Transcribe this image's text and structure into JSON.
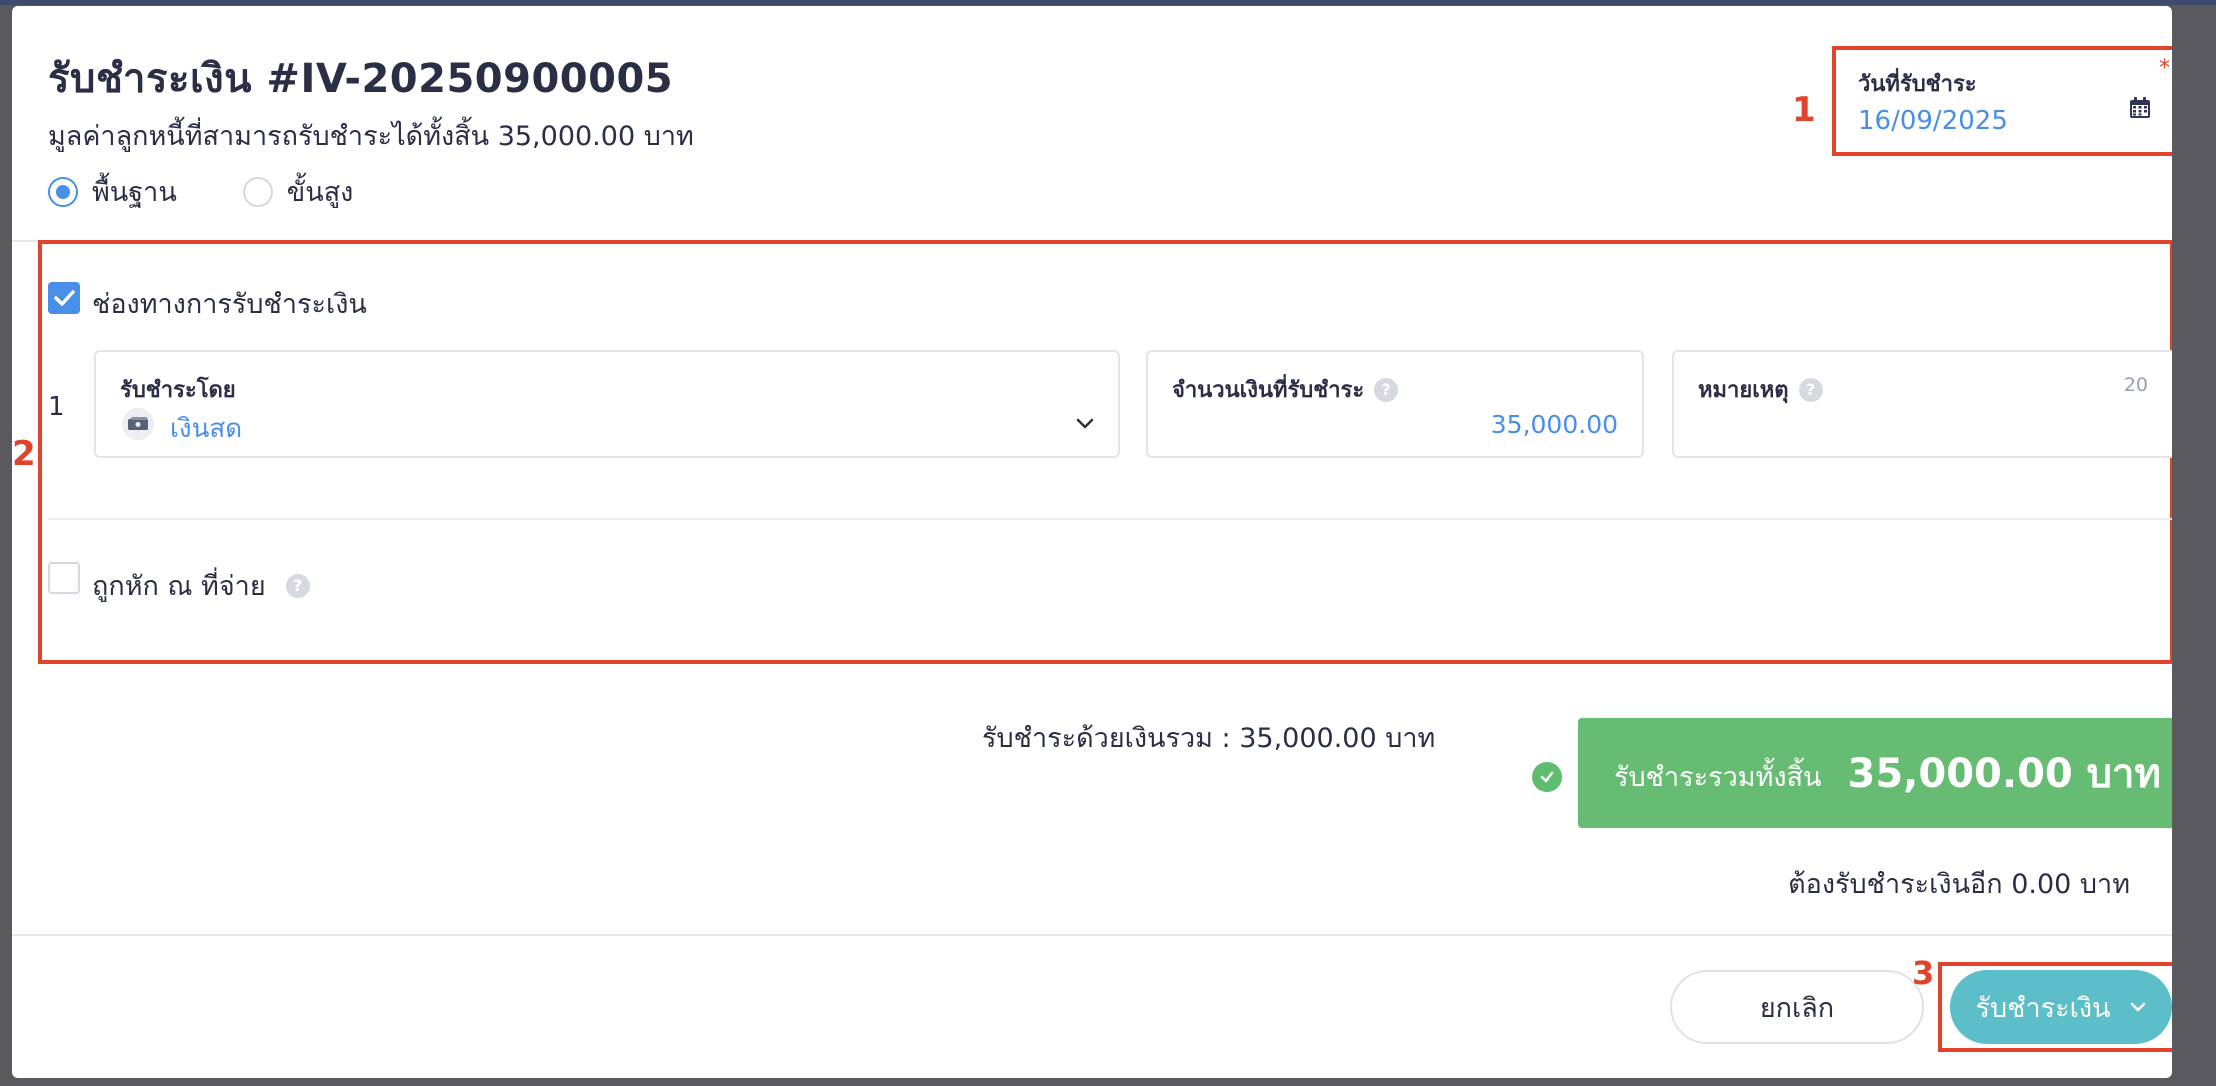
{
  "header": {
    "title": "รับชำระเงิน #IV-20250900005",
    "subtitle": "มูลค่าลูกหนี้ที่สามารถรับชำระได้ทั้งสิ้น 35,000.00 บาท"
  },
  "mode": {
    "options": [
      {
        "label": "พื้นฐาน",
        "selected": true
      },
      {
        "label": "ขั้นสูง",
        "selected": false
      }
    ]
  },
  "date": {
    "label": "วันที่รับชำระ",
    "required_mark": "*",
    "value": "16/09/2025",
    "icon": "calendar-icon"
  },
  "annotations": [
    "1",
    "2",
    "3"
  ],
  "payment_channel": {
    "label": "ช่องทางการรับชำระเงิน",
    "checked": true,
    "rows": [
      {
        "index": "1",
        "method_label": "รับชำระโดย",
        "method_value": "เงินสด",
        "method_icon": "cash-icon",
        "amount_label": "จำนวนเงินที่รับชำระ",
        "amount_value": "35,000.00",
        "note_label": "หมายเหตุ",
        "note_counter": "20"
      }
    ]
  },
  "withholding": {
    "label": "ถูกหัก ณ ที่จ่าย",
    "checked": false
  },
  "summary": {
    "paid_with_total": "รับชำระด้วยเงินรวม :  35,000.00 บาท",
    "total_label": "รับชำระรวมทั้งสิ้น",
    "total_value": "35,000.00 บาท",
    "remaining": "ต้องรับชำระเงินอีก 0.00 บาท"
  },
  "footer": {
    "cancel_label": "ยกเลิก",
    "submit_label": "รับชำระเงิน"
  },
  "colors": {
    "accent": "#4a8fe7",
    "annotation": "#e2432b",
    "total_bg": "#66bc73",
    "submit_bg": "#5bbec9"
  }
}
